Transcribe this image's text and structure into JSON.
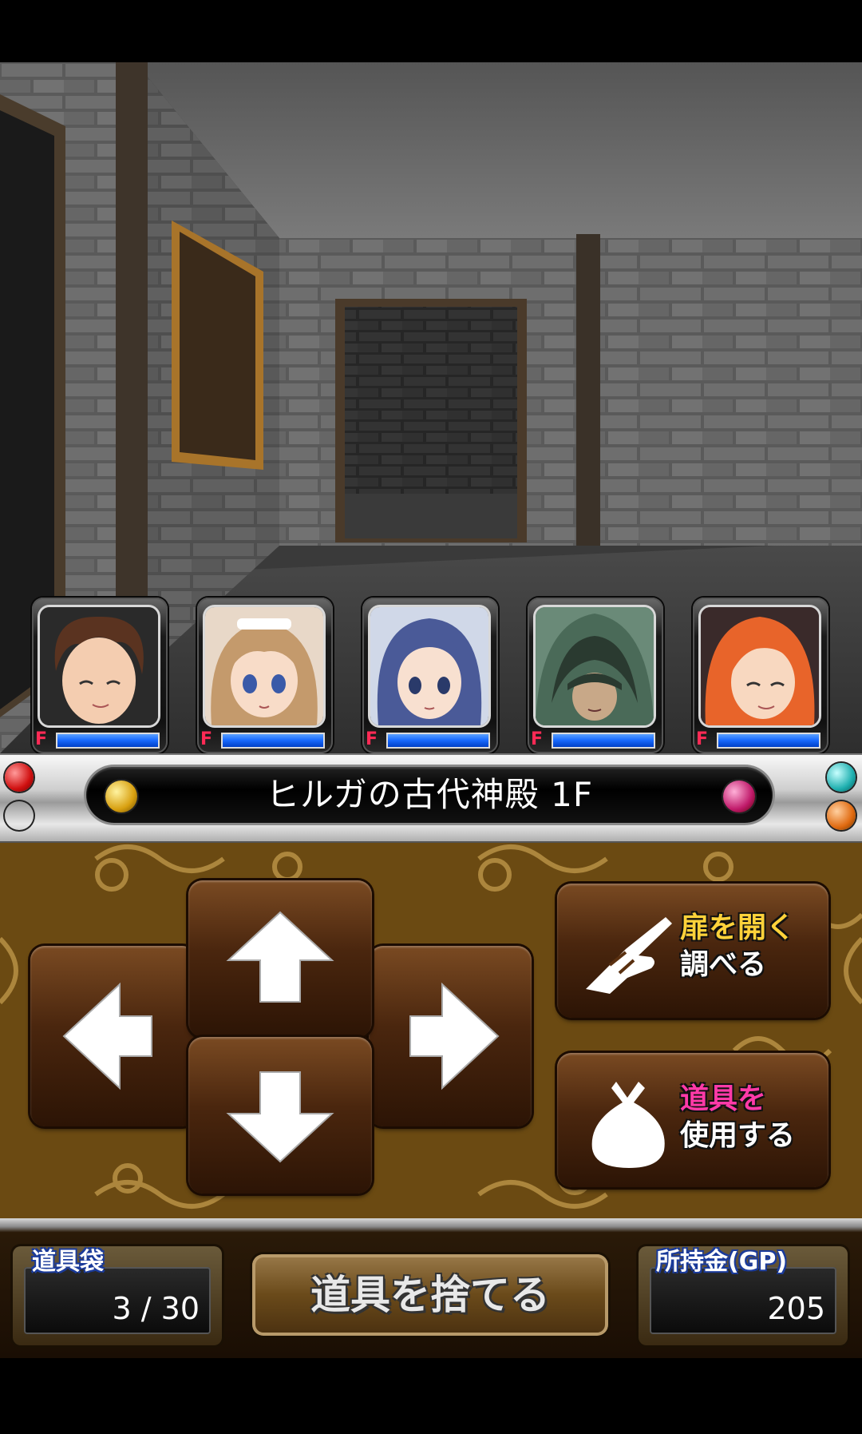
{
  "location": {
    "name": "ヒルガの古代神殿 1F"
  },
  "party": [
    {
      "portrait": "brown-haired-boy-smiling",
      "status": "F",
      "hp": 1.0
    },
    {
      "portrait": "girl-maid-headdress",
      "status": "F",
      "hp": 1.0
    },
    {
      "portrait": "blue-haired-girl",
      "status": "F",
      "hp": 1.0
    },
    {
      "portrait": "green-hooded-figure",
      "status": "F",
      "hp": 1.0
    },
    {
      "portrait": "orange-haired-smiling",
      "status": "F",
      "hp": 1.0
    }
  ],
  "controls": {
    "up_icon": "arrow-up-icon",
    "down_icon": "arrow-down-icon",
    "left_icon": "arrow-left-icon",
    "right_icon": "arrow-right-icon",
    "open_door": {
      "icon": "pointing-hand-icon",
      "line1": "扉を開く",
      "line2": "調べる"
    },
    "use_item": {
      "icon": "item-bag-icon",
      "line1": "道具を",
      "line2": "使用する"
    }
  },
  "inventory": {
    "label": "道具袋",
    "value": "3 / 30"
  },
  "discard": {
    "label": "道具を捨てる"
  },
  "gold": {
    "label": "所持金(GP)",
    "value": "205"
  },
  "colors": {
    "hp_bar": "#1a6cff",
    "label_yellow": "#ffd23a",
    "label_pink": "#ff3aa8",
    "panel_brown": "#6b4a12"
  }
}
